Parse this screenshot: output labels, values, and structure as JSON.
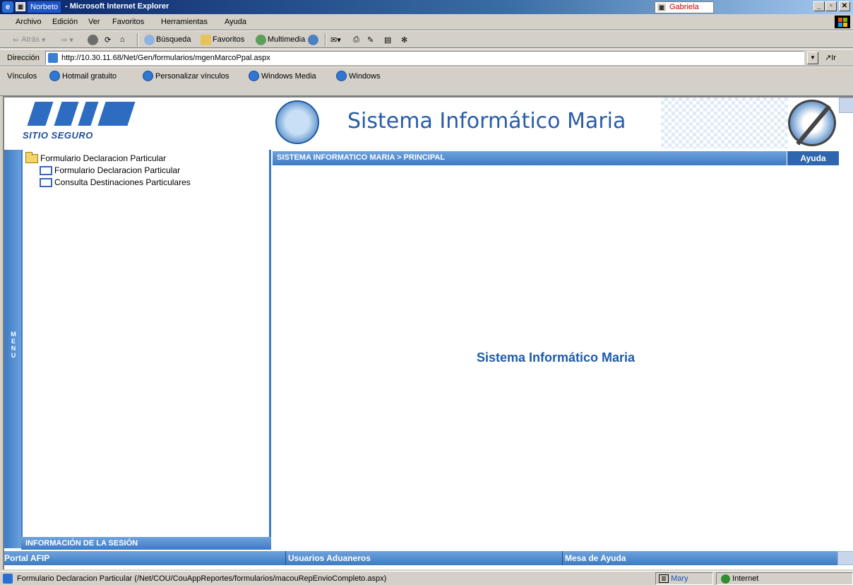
{
  "window": {
    "user_tag": "Norbeto",
    "title": "- Microsoft Internet Explorer",
    "badge": "Gabriela"
  },
  "menubar": {
    "items": [
      "Archivo",
      "Edición",
      "Ver",
      "Favoritos",
      "Herramientas",
      "Ayuda"
    ]
  },
  "toolbar": {
    "back": "Atrás",
    "search": "Búsqueda",
    "favorites": "Favoritos",
    "multimedia": "Multimedia"
  },
  "address": {
    "label": "Dirección",
    "url": "http://10.30.11.68/Net/Gen/formularios/mgenMarcoPpal.aspx",
    "go": "Ir"
  },
  "links": {
    "label": "Vínculos",
    "items": [
      "Hotmail gratuito",
      "Personalizar vínculos",
      "Windows Media",
      "Windows"
    ]
  },
  "banner": {
    "logo_text": "SITIO SEGURO",
    "title": "Sistema Informático Maria"
  },
  "left_panel": {
    "menu_letters": [
      "M",
      "E",
      "N",
      "U"
    ],
    "tree_root": "Formulario Declaracion Particular",
    "tree_items": [
      "Formulario Declaracion Particular",
      "Consulta Destinaciones Particulares"
    ],
    "session": "INFORMACIÓN DE LA SESIÓN"
  },
  "content": {
    "breadcrumb": "SISTEMA INFORMATICO MARIA > PRINCIPAL",
    "help": "Ayuda",
    "center_title": "Sistema Informático Maria"
  },
  "footer": {
    "portal": "Portal AFIP",
    "users": "Usuarios Aduaneros",
    "help_desk": "Mesa de Ayuda"
  },
  "statusbar": {
    "text": "Formulario Declaracion Particular (/Net/COU/CouAppReportes/formularios/macouRepEnvioCompleto.aspx)",
    "user": "Mary",
    "zone": "Internet"
  },
  "colors": {
    "accent_blue": "#3d7bc4",
    "title_text": "#1e5aa8"
  }
}
